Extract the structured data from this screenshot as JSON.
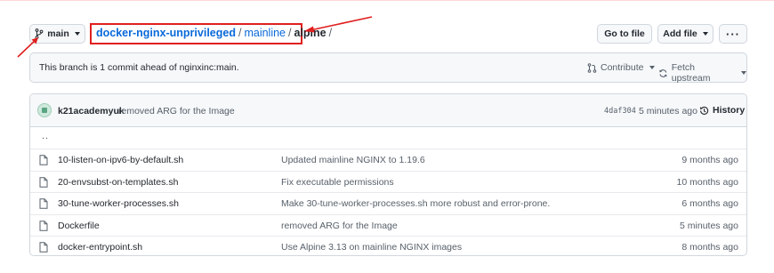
{
  "branch": {
    "name": "main"
  },
  "breadcrumb": {
    "repo": "docker-nginx-unprivileged",
    "sep1": "/",
    "folder": "mainline",
    "sep2": "/",
    "current": "alpine",
    "sep3": "/"
  },
  "actions": {
    "goto_file": "Go to file",
    "add_file": "Add file",
    "more": "···"
  },
  "ahead_bar": {
    "text": "This branch is 1 commit ahead of nginxinc:main.",
    "contribute": "Contribute",
    "fetch_upstream": "Fetch upstream"
  },
  "latest_commit": {
    "author": "k21academyuk",
    "message": "removed ARG for the Image",
    "hash": "4daf304",
    "time": "5 minutes ago",
    "history": "History"
  },
  "parent_dir": "..",
  "files": [
    {
      "name": "10-listen-on-ipv6-by-default.sh",
      "message": "Updated mainline NGINX to 1.19.6",
      "age": "9 months ago"
    },
    {
      "name": "20-envsubst-on-templates.sh",
      "message": "Fix executable permissions",
      "age": "10 months ago"
    },
    {
      "name": "30-tune-worker-processes.sh",
      "message": "Make 30-tune-worker-processes.sh more robust and error-prone.",
      "age": "6 months ago"
    },
    {
      "name": "Dockerfile",
      "message": "removed ARG for the Image",
      "age": "5 minutes ago"
    },
    {
      "name": "docker-entrypoint.sh",
      "message": "Use Alpine 3.13 on mainline NGINX images",
      "age": "8 months ago"
    }
  ],
  "colors": {
    "annotation": "#e02020",
    "link": "#0969da"
  }
}
